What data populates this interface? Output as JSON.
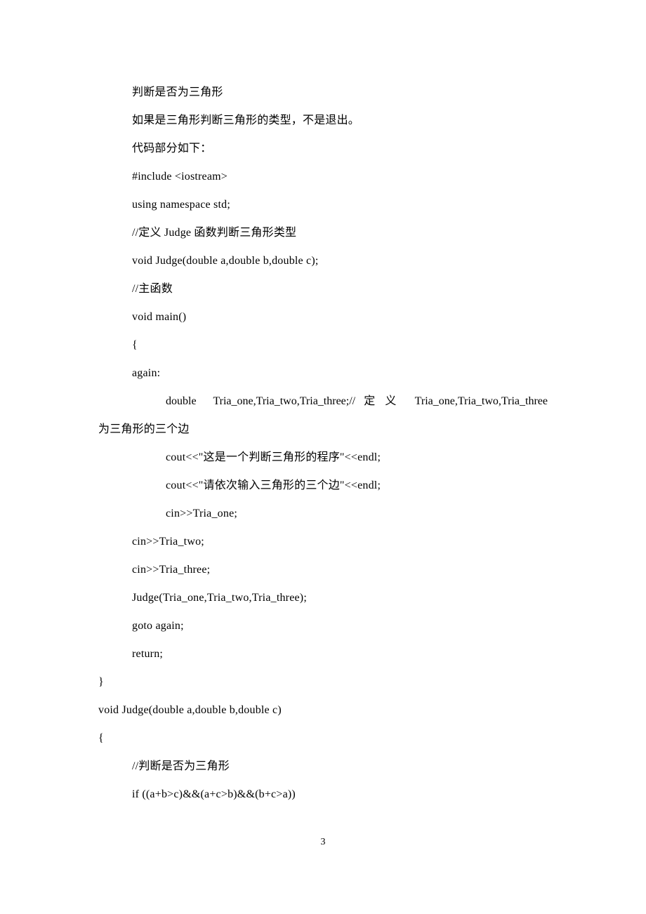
{
  "lines": [
    "判断是否为三角形",
    "如果是三角形判断三角形的类型，不是退出。",
    "",
    "代码部分如下：",
    "#include <iostream>",
    "using namespace std;",
    "",
    "//定义 Judge 函数判断三角形类型",
    "void Judge(double a,double b,double c);",
    "",
    "//主函数",
    "void main()",
    "{",
    "again:",
    "double  Tria_one,Tria_two,Tria_three;// 定 义  Tria_one,Tria_two,Tria_three",
    "为三角形的三个边",
    "cout<<\"这是一个判断三角形的程序\"<<endl;",
    "cout<<\"请依次输入三角形的三个边\"<<endl;",
    "cin>>Tria_one;",
    "cin>>Tria_two;",
    "cin>>Tria_three;",
    "Judge(Tria_one,Tria_two,Tria_three);",
    "goto again;",
    "return;",
    "}",
    "",
    "void Judge(double a,double b,double c)",
    "{",
    "//判断是否为三角形",
    "if ((a+b>c)&&(a+c>b)&&(b+c>a))"
  ],
  "page_number": "3"
}
